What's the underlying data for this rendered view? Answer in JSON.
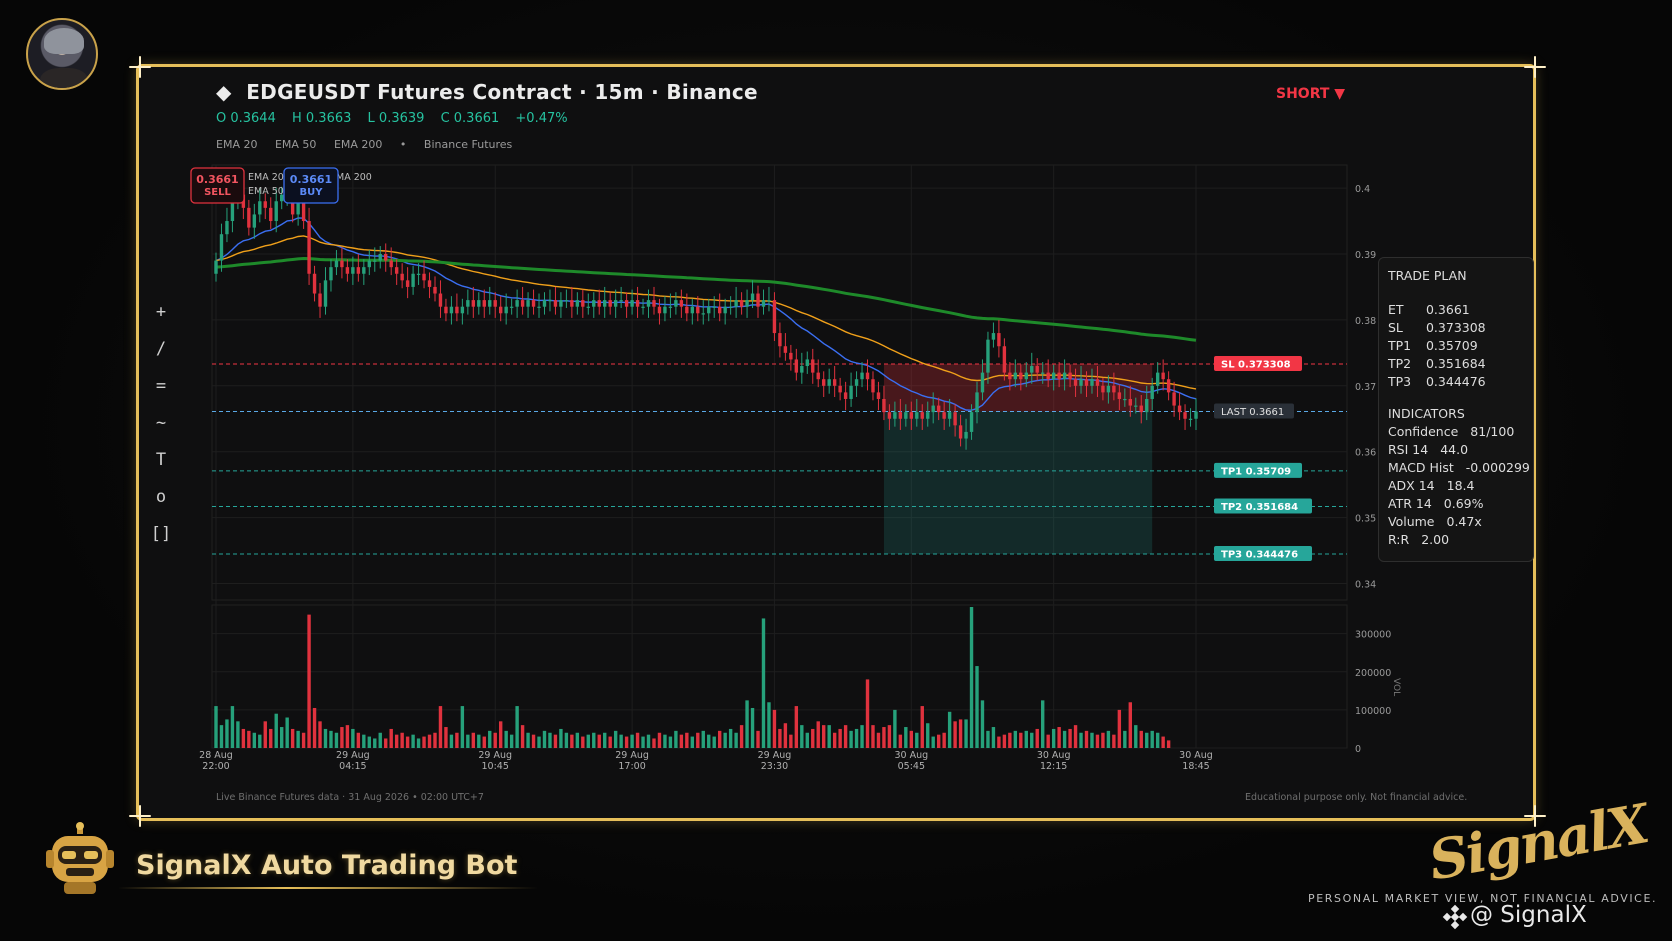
{
  "header": {
    "title": "EDGEUSDT Futures Contract · 15m · Binance",
    "title_icon": "diamond-icon",
    "ohlc": {
      "open": "O 0.3644",
      "high": "H 0.3663",
      "low": "L 0.3639",
      "close": "C 0.3661",
      "change": "+0.47%"
    },
    "legend": [
      "EMA 20",
      "EMA 50",
      "EMA 200",
      "•",
      "Binance Futures"
    ],
    "direction": "SHORT ▼"
  },
  "toolbar": [
    "+",
    "/",
    "=",
    "~",
    "T",
    "o",
    "[]"
  ],
  "order_buttons": {
    "sell": {
      "price": "0.3661",
      "label": "SELL"
    },
    "buy": {
      "price": "0.3661",
      "label": "BUY"
    }
  },
  "overlay_legend": {
    "ema20": "EMA 20",
    "ema50": "EMA 50",
    "ema200_fragment": "MA 200"
  },
  "price_lines": {
    "sl": "SL  0.373308",
    "last": "LAST  0.3661",
    "tp1": "TP1  0.35709",
    "tp2": "TP2  0.351684",
    "tp3": "TP3  0.344476"
  },
  "trade_plan": {
    "title": "TRADE PLAN",
    "entries": [
      {
        "k": "ET",
        "v": "0.3661"
      },
      {
        "k": "SL",
        "v": "0.373308"
      },
      {
        "k": "TP1",
        "v": "0.35709"
      },
      {
        "k": "TP2",
        "v": "0.351684"
      },
      {
        "k": "TP3",
        "v": "0.344476"
      }
    ],
    "indicators_title": "INDICATORS",
    "indicators": [
      {
        "k": "Confidence",
        "v": "81/100"
      },
      {
        "k": "RSI 14",
        "v": "44.0"
      },
      {
        "k": "MACD Hist",
        "v": "-0.000299"
      },
      {
        "k": "ADX 14",
        "v": "18.4"
      },
      {
        "k": "ATR 14",
        "v": "0.69%"
      },
      {
        "k": "Volume",
        "v": "0.47x"
      },
      {
        "k": "R:R",
        "v": "2.00"
      }
    ]
  },
  "footer": {
    "left": "Live Binance Futures data  ·  31 Aug 2026 • 02:00 UTC+7",
    "right": "Educational purpose only. Not financial advice."
  },
  "branding": {
    "bot_title": "SignalX Auto Trading Bot",
    "logo_text": "SignalX",
    "tagline": "PERSONAL MARKET VIEW, NOT FINANCIAL ADVICE.",
    "handle": "@ SignalX"
  },
  "colors": {
    "up": "#26a17b",
    "down": "#e0323e",
    "ema20": "#3b6ff2",
    "ema50": "#f0a01a",
    "ema200": "#1e8a2a",
    "sl": "#f23645",
    "tp": "#26a69a",
    "last": "#5aa9e6",
    "gold": "#e6bf5a"
  },
  "chart_data": {
    "type": "candlestick",
    "price_axis": {
      "ticks": [
        "0.4",
        "0.39",
        "0.38",
        "0.37",
        "0.36",
        "0.35",
        "0.34"
      ],
      "ylim": [
        0.3375,
        0.4035
      ]
    },
    "volume_axis": {
      "label": "VOL",
      "ticks": [
        "300000",
        "200000",
        "100000",
        "0"
      ],
      "ylim": [
        0,
        370000
      ]
    },
    "time_ticks": [
      {
        "date": "28 Aug",
        "time": "22:00",
        "idx": 0
      },
      {
        "date": "29 Aug",
        "time": "04:15",
        "idx": 25
      },
      {
        "date": "29 Aug",
        "time": "10:45",
        "idx": 51
      },
      {
        "date": "29 Aug",
        "time": "17:00",
        "idx": 76
      },
      {
        "date": "29 Aug",
        "time": "23:30",
        "idx": 102
      },
      {
        "date": "30 Aug",
        "time": "05:45",
        "idx": 127
      },
      {
        "date": "30 Aug",
        "time": "12:15",
        "idx": 153
      },
      {
        "date": "30 Aug",
        "time": "18:45",
        "idx": 179
      }
    ],
    "levels": {
      "sl": 0.373308,
      "last": 0.3661,
      "tp1": 0.35709,
      "tp2": 0.351684,
      "tp3": 0.344476
    },
    "position_zone": {
      "start_idx": 122,
      "end_idx": 171
    },
    "close": [
      0.389,
      0.393,
      0.395,
      0.398,
      0.399,
      0.397,
      0.394,
      0.396,
      0.398,
      0.397,
      0.395,
      0.398,
      0.399,
      0.4,
      0.396,
      0.399,
      0.395,
      0.387,
      0.384,
      0.382,
      0.386,
      0.388,
      0.389,
      0.388,
      0.387,
      0.388,
      0.387,
      0.388,
      0.389,
      0.389,
      0.39,
      0.389,
      0.388,
      0.387,
      0.386,
      0.385,
      0.387,
      0.387,
      0.386,
      0.385,
      0.384,
      0.382,
      0.381,
      0.382,
      0.381,
      0.382,
      0.383,
      0.382,
      0.383,
      0.382,
      0.383,
      0.382,
      0.381,
      0.382,
      0.382,
      0.383,
      0.382,
      0.383,
      0.382,
      0.382,
      0.383,
      0.383,
      0.382,
      0.383,
      0.383,
      0.382,
      0.383,
      0.382,
      0.382,
      0.383,
      0.382,
      0.383,
      0.382,
      0.383,
      0.383,
      0.382,
      0.383,
      0.382,
      0.382,
      0.383,
      0.382,
      0.381,
      0.382,
      0.382,
      0.383,
      0.382,
      0.381,
      0.382,
      0.381,
      0.381,
      0.382,
      0.382,
      0.381,
      0.382,
      0.382,
      0.383,
      0.382,
      0.383,
      0.384,
      0.382,
      0.383,
      0.383,
      0.378,
      0.376,
      0.375,
      0.374,
      0.372,
      0.373,
      0.374,
      0.372,
      0.371,
      0.37,
      0.371,
      0.37,
      0.369,
      0.368,
      0.37,
      0.371,
      0.372,
      0.371,
      0.369,
      0.368,
      0.366,
      0.365,
      0.366,
      0.365,
      0.366,
      0.365,
      0.366,
      0.365,
      0.366,
      0.367,
      0.366,
      0.365,
      0.366,
      0.364,
      0.362,
      0.363,
      0.366,
      0.369,
      0.372,
      0.377,
      0.378,
      0.376,
      0.372,
      0.371,
      0.372,
      0.371,
      0.372,
      0.373,
      0.372,
      0.372,
      0.371,
      0.372,
      0.371,
      0.372,
      0.371,
      0.37,
      0.371,
      0.37,
      0.371,
      0.37,
      0.369,
      0.37,
      0.369,
      0.368,
      0.368,
      0.367,
      0.367,
      0.366,
      0.368,
      0.37,
      0.372,
      0.371,
      0.369,
      0.367,
      0.366,
      0.365,
      0.365,
      0.3661
    ],
    "volume": [
      110000,
      60000,
      75000,
      110000,
      70000,
      50000,
      45000,
      40000,
      35000,
      70000,
      50000,
      90000,
      55000,
      80000,
      50000,
      45000,
      40000,
      350000,
      105000,
      70000,
      50000,
      45000,
      40000,
      55000,
      60000,
      50000,
      40000,
      35000,
      30000,
      25000,
      40000,
      25000,
      50000,
      35000,
      40000,
      30000,
      35000,
      25000,
      30000,
      35000,
      40000,
      110000,
      55000,
      35000,
      40000,
      110000,
      35000,
      40000,
      35000,
      30000,
      45000,
      40000,
      70000,
      45000,
      35000,
      110000,
      60000,
      40000,
      35000,
      30000,
      45000,
      40000,
      35000,
      50000,
      40000,
      35000,
      40000,
      30000,
      35000,
      40000,
      35000,
      40000,
      30000,
      45000,
      35000,
      30000,
      35000,
      40000,
      30000,
      35000,
      25000,
      40000,
      35000,
      30000,
      45000,
      35000,
      40000,
      30000,
      40000,
      45000,
      35000,
      30000,
      45000,
      40000,
      50000,
      40000,
      60000,
      125000,
      105000,
      45000,
      340000,
      120000,
      100000,
      50000,
      65000,
      35000,
      110000,
      60000,
      40000,
      50000,
      70000,
      60000,
      60000,
      40000,
      50000,
      60000,
      45000,
      50000,
      60000,
      180000,
      60000,
      40000,
      55000,
      60000,
      100000,
      35000,
      55000,
      45000,
      40000,
      110000,
      65000,
      30000,
      35000,
      40000,
      95000,
      70000,
      75000,
      75000,
      370000,
      215000,
      125000,
      45000,
      55000,
      30000,
      35000,
      40000,
      45000,
      40000,
      45000,
      40000,
      50000,
      125000,
      35000,
      50000,
      55000,
      45000,
      50000,
      60000,
      40000,
      45000,
      40000,
      35000,
      40000,
      45000,
      35000,
      100000,
      45000,
      120000,
      60000,
      45000,
      40000,
      45000,
      40000,
      30000,
      20000
    ]
  }
}
